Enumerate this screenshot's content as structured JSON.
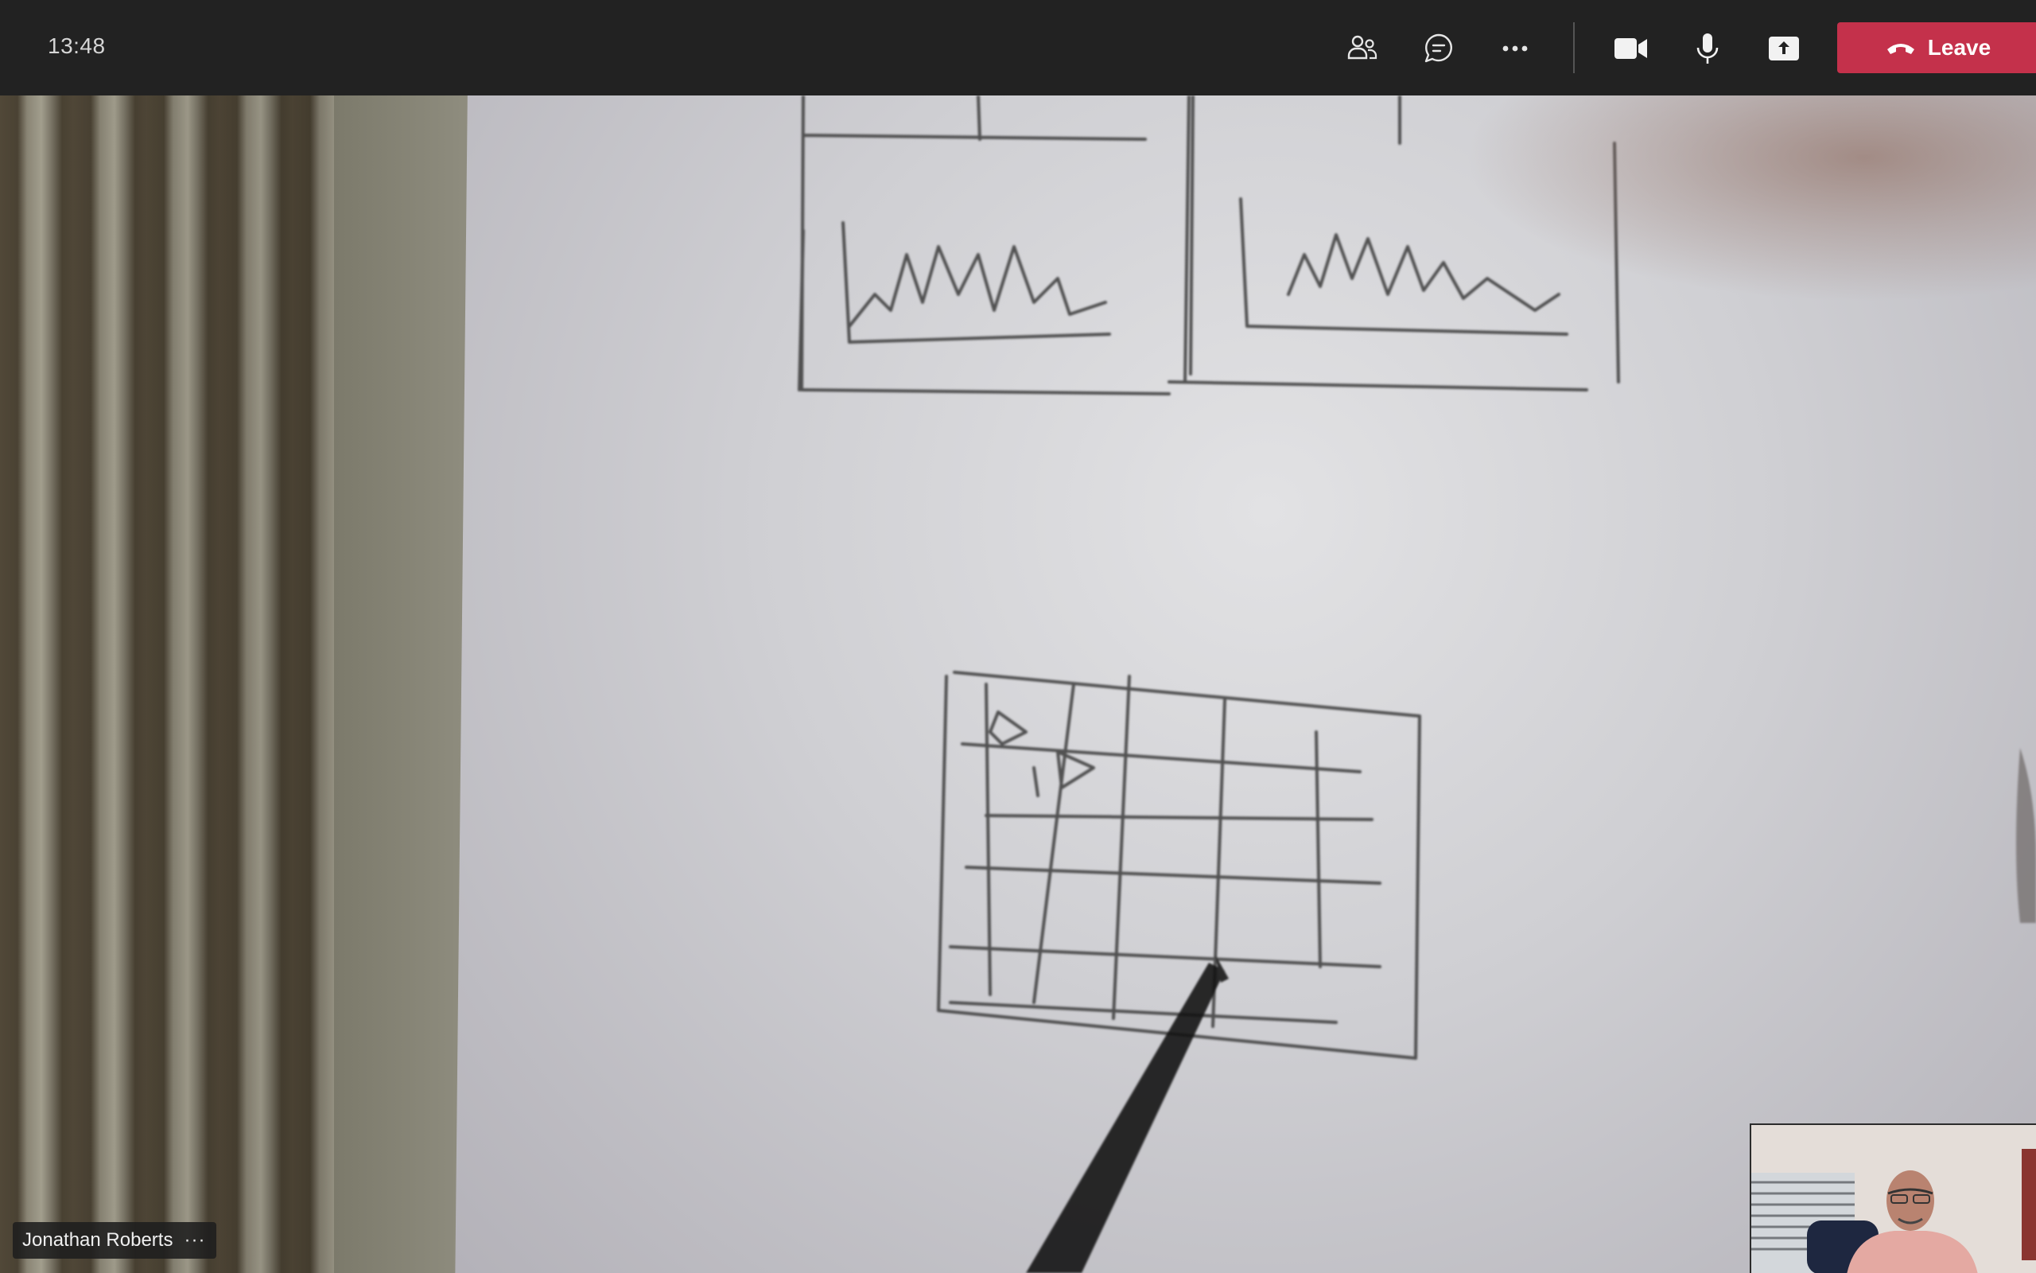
{
  "meeting": {
    "clock": "13:48"
  },
  "toolbar": {
    "leave_label": "Leave",
    "buttons": [
      {
        "name": "participants",
        "icon": "people-icon"
      },
      {
        "name": "chat",
        "icon": "chat-icon"
      },
      {
        "name": "more-actions",
        "icon": "ellipsis-icon"
      },
      {
        "name": "camera",
        "icon": "video-camera-icon"
      },
      {
        "name": "mic",
        "icon": "microphone-icon"
      },
      {
        "name": "share",
        "icon": "share-screen-icon"
      }
    ],
    "leave_color": "#c4314b"
  },
  "participant": {
    "name": "Jonathan Roberts",
    "more": "···"
  },
  "colors": {
    "topbar": "#222222",
    "accent": "#c4314b"
  }
}
